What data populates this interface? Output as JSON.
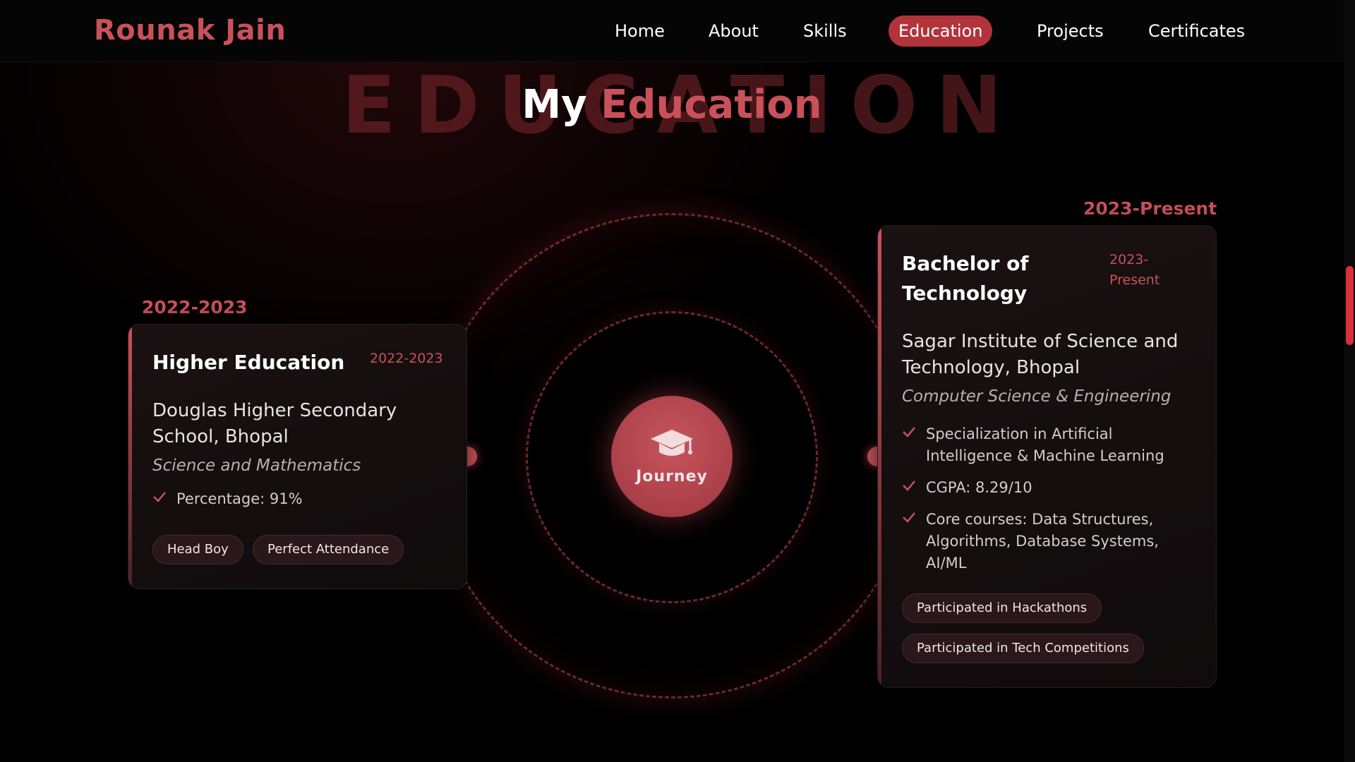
{
  "brand": {
    "name": "Rounak Jain",
    "accent_color": "#c9515a"
  },
  "nav": {
    "items": [
      "Home",
      "About",
      "Skills",
      "Education",
      "Projects",
      "Certificates"
    ],
    "active": "Education"
  },
  "section": {
    "watermark": "EDUCATION",
    "title_prefix": "My",
    "title_highlight": "Education"
  },
  "orbit": {
    "center_icon": "graduation-cap-icon",
    "center_label": "Journey"
  },
  "education": [
    {
      "year_label": "2022-2023",
      "title": "Higher Education",
      "date": "2022-2023",
      "school": "Douglas Higher Secondary School, Bhopal",
      "field": "Science and Mathematics",
      "bullets": [
        "Percentage: 91%"
      ],
      "tags": [
        "Head Boy",
        "Perfect Attendance"
      ]
    },
    {
      "year_label": "2023-Present",
      "title": "Bachelor of Technology",
      "date": "2023-Present",
      "school": "Sagar Institute of Science and Technology, Bhopal",
      "field": "Computer Science & Engineering",
      "bullets": [
        "Specialization in Artificial Intelligence & Machine Learning",
        "CGPA: 8.29/10",
        "Core courses: Data Structures, Algorithms, Database Systems, AI/ML"
      ],
      "tags": [
        "Participated in Hackathons",
        "Participated in Tech Competitions"
      ]
    }
  ]
}
